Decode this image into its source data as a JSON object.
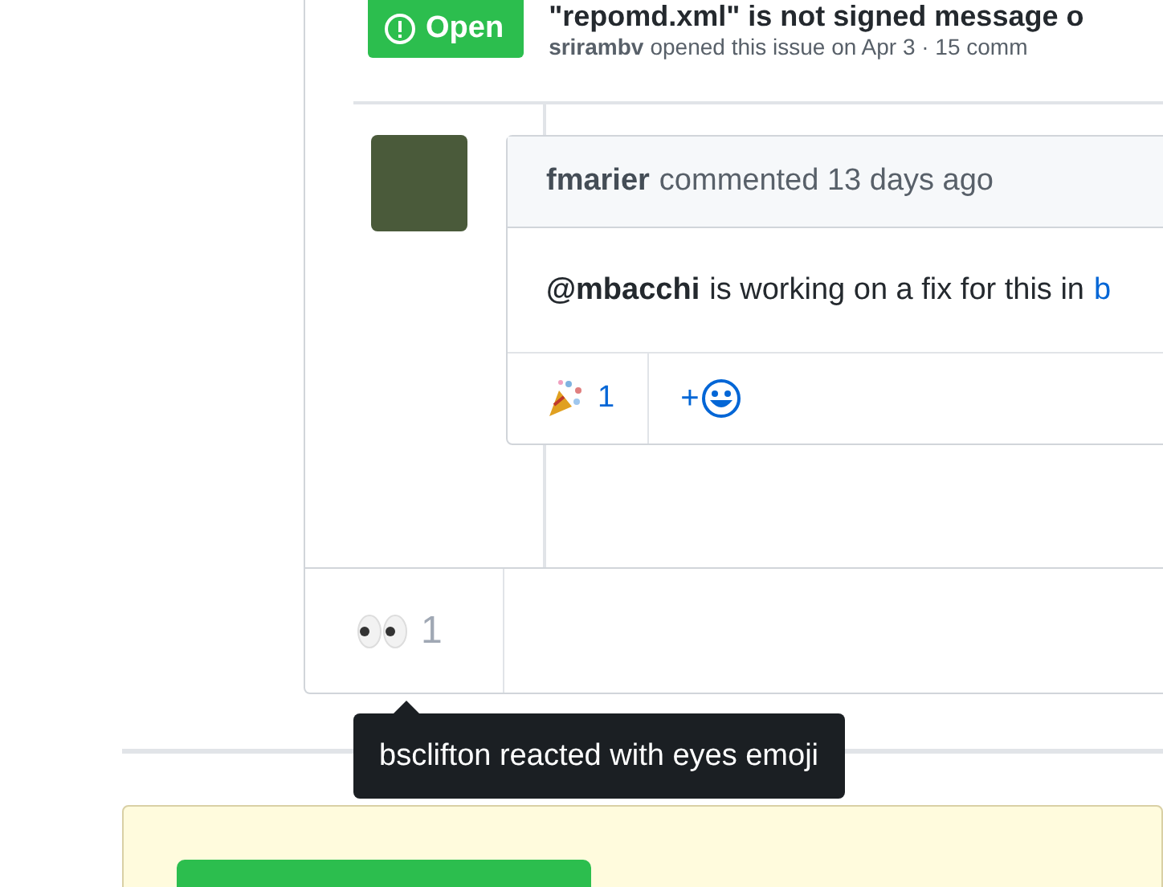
{
  "issue": {
    "state": "Open",
    "title": "\"repomd.xml\" is not signed message o",
    "author": "srirambv",
    "meta": "opened this issue on Apr 3 · 15 comm"
  },
  "comment": {
    "author": "fmarier",
    "time": "commented 13 days ago",
    "mention": "@mbacchi",
    "body": "is working on a fix for this in",
    "link": "b",
    "reactions": [
      {
        "kind": "tada",
        "count": "1"
      }
    ],
    "add_reaction": "+"
  },
  "issue_reactions": [
    {
      "kind": "eyes",
      "count": "1"
    }
  ],
  "tooltip": "bsclifton reacted with eyes emoji"
}
